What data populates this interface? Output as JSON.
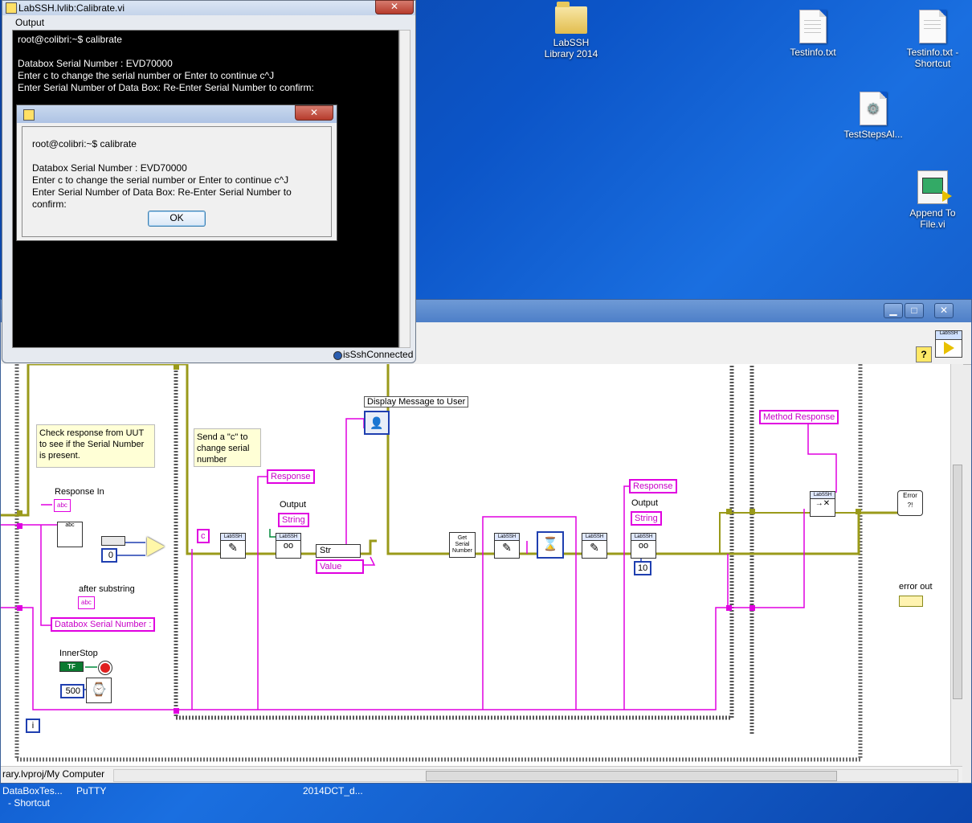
{
  "desktop": {
    "icons": [
      {
        "label": "LabSSH Library 2014",
        "line1": "LabSSH",
        "line2": "Library 2014"
      },
      {
        "label": "Testinfo.txt",
        "line1": "Testinfo.txt",
        "line2": ""
      },
      {
        "label": "Testinfo.txt - Shortcut",
        "line1": "Testinfo.txt -",
        "line2": "Shortcut"
      },
      {
        "label": "TestStepsAl...",
        "line1": "TestStepsAl...",
        "line2": ""
      },
      {
        "label": "Append To File.vi",
        "line1": "Append To",
        "line2": "File.vi"
      }
    ],
    "taskbar_items": [
      "DataBoxTes...",
      "- Shortcut",
      "PuTTY",
      "2014DCT_d..."
    ]
  },
  "front_panel": {
    "title": "LabSSH.lvlib:Calibrate.vi",
    "output_label": "Output",
    "terminal_lines": [
      "root@colibri:~$ calibrate",
      "",
      "Databox Serial Number : EVD70000",
      "Enter c to change the serial number or Enter to continue c^J",
      "Enter Serial Number of Data Box: Re-Enter Serial Number to confirm:"
    ],
    "connected_label": "isSshConnected",
    "close_symbol": "✕"
  },
  "dialog": {
    "close_symbol": "✕",
    "lines": [
      "root@colibri:~$ calibrate",
      "",
      "Databox Serial Number : EVD70000",
      "Enter c to change the serial number or Enter to continue c^J",
      "Enter Serial Number of Data Box: Re-Enter Serial Number to confirm:"
    ],
    "ok_label": "OK"
  },
  "block_diagram": {
    "window_buttons": [
      "▁",
      "□",
      "✕"
    ],
    "help_symbol": "?",
    "notes": {
      "check_response": "Check response from UUT to see if the Serial Number is present.",
      "send_c": "Send a \"c\" to change serial number"
    },
    "labels": {
      "response_in": "Response In",
      "after_substring": "after substring",
      "inner_stop": "InnerStop",
      "output_1": "Output",
      "output_2": "Output",
      "display_message": "Display Message to User",
      "error_out": "error out"
    },
    "constants": {
      "zero": "0",
      "c": "c",
      "timeout": "500",
      "ten": "10",
      "info": "i"
    },
    "terminals": {
      "response_1": "Response",
      "response_2": "Response",
      "string_1": "String",
      "string_2": "String",
      "value": "Value",
      "str": "Str",
      "databox_serial": "Databox Serial Number :",
      "method_response": "Method Response",
      "get_serial": "Get Serial Number",
      "labssh": "LabSSH",
      "abc": "abc",
      "tf": "TF",
      "error": "Error"
    },
    "status_path": "rary.lvproj/My Computer"
  },
  "colors": {
    "desktop": "#0c55c8",
    "wire_error": "#9a9a1a",
    "wire_string": "#e000e0",
    "wire_numeric": "#1f3fb0"
  }
}
